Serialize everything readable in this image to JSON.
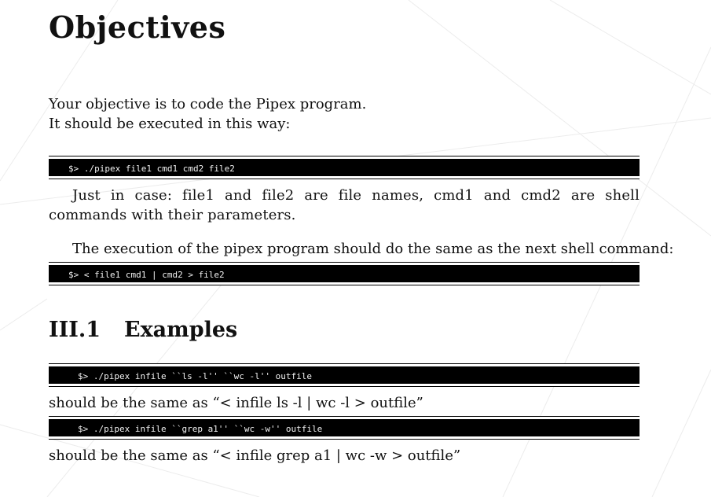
{
  "heading": "Objectives",
  "intro_line1": "Your objective is to code the Pipex program.",
  "intro_line2": "It should be executed in this way:",
  "code_usage": "$> ./pipex file1 cmd1 cmd2 file2",
  "note_text": "Just in case: file1 and file2 are file names, cmd1 and cmd2 are shell commands with their parameters.",
  "equivalence_text": "The execution of the pipex program should do the same as the next shell command:",
  "code_shell": "$> < file1 cmd1 | cmd2 > file2",
  "section": {
    "number": "III.1",
    "title": "Examples"
  },
  "examples": [
    {
      "code": "$> ./pipex infile ``ls -l'' ``wc -l'' outfile",
      "result": "should be the same as “< infile ls -l | wc -l > outfile”"
    },
    {
      "code": "$> ./pipex infile ``grep a1'' ``wc -w'' outfile",
      "result": "should be the same as “< infile grep a1 | wc -w > outfile”"
    }
  ]
}
